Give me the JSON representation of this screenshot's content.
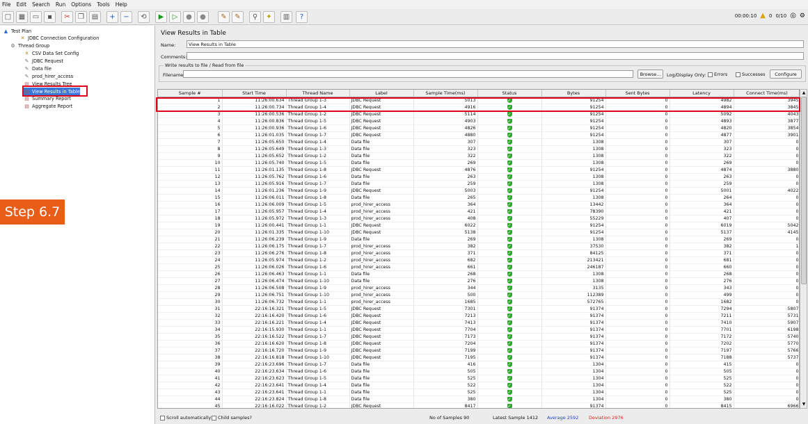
{
  "menu": [
    "File",
    "Edit",
    "Search",
    "Run",
    "Options",
    "Tools",
    "Help"
  ],
  "toolbar": {
    "timer": "00:00:10",
    "warnings": "0",
    "threads": "0/10"
  },
  "tree": [
    {
      "label": "Test Plan",
      "icon": "test-plan-icon"
    },
    {
      "label": "JDBC Connection Configuration",
      "icon": "config-icon"
    },
    {
      "label": "Thread Group",
      "icon": "thread-group-icon"
    },
    {
      "label": "CSV Data Set Config",
      "icon": "config-icon"
    },
    {
      "label": "JDBC Request",
      "icon": "sampler-icon"
    },
    {
      "label": "Data file",
      "icon": "sampler-icon"
    },
    {
      "label": "prod_hirer_access",
      "icon": "sampler-icon"
    },
    {
      "label": "View Results Tree",
      "icon": "listener-icon"
    },
    {
      "label": "View Results in Table",
      "icon": "listener-icon"
    },
    {
      "label": "Summary Report",
      "icon": "listener-icon"
    },
    {
      "label": "Aggregate Report",
      "icon": "listener-icon"
    }
  ],
  "step_label": "Step 6.7",
  "panel": {
    "title": "View Results in Table",
    "name_label": "Name:",
    "name_value": "View Results in Table",
    "comments_label": "Comments:",
    "write_group": "Write results to file / Read from file",
    "filename_label": "Filename",
    "browse": "Browse...",
    "log_display": "Log/Display Only:",
    "errors": "Errors",
    "successes": "Successes",
    "configure": "Configure"
  },
  "table": {
    "headers": [
      "Sample #",
      "Start Time",
      "Thread Name",
      "Label",
      "Sample Time(ms)",
      "Status",
      "Bytes",
      "Sent Bytes",
      "Latency",
      "Connect Time(ms)"
    ],
    "rows": [
      [
        "1",
        "11:26:00.634",
        "Thread Group 1-3",
        "JDBC Request",
        "5013",
        "91254",
        "0",
        "4982",
        "3945"
      ],
      [
        "2",
        "11:26:00.734",
        "Thread Group 1-4",
        "JDBC Request",
        "4916",
        "91254",
        "0",
        "4894",
        "3845"
      ],
      [
        "3",
        "11:26:00.536",
        "Thread Group 1-2",
        "JDBC Request",
        "5114",
        "91254",
        "0",
        "5092",
        "4043"
      ],
      [
        "4",
        "11:26:00.836",
        "Thread Group 1-5",
        "JDBC Request",
        "4903",
        "91254",
        "0",
        "4893",
        "3877"
      ],
      [
        "5",
        "11:26:00.936",
        "Thread Group 1-6",
        "JDBC Request",
        "4826",
        "91254",
        "0",
        "4820",
        "3854"
      ],
      [
        "6",
        "11:26:01.035",
        "Thread Group 1-7",
        "JDBC Request",
        "4880",
        "91254",
        "0",
        "4877",
        "3901"
      ],
      [
        "7",
        "11:26:05.650",
        "Thread Group 1-4",
        "Data file",
        "307",
        "1308",
        "0",
        "307",
        "0"
      ],
      [
        "8",
        "11:26:05.649",
        "Thread Group 1-3",
        "Data file",
        "323",
        "1308",
        "0",
        "323",
        "0"
      ],
      [
        "9",
        "11:26:05.652",
        "Thread Group 1-2",
        "Data file",
        "322",
        "1308",
        "0",
        "322",
        "0"
      ],
      [
        "10",
        "11:26:05.740",
        "Thread Group 1-5",
        "Data file",
        "269",
        "1308",
        "0",
        "269",
        "0"
      ],
      [
        "11",
        "11:26:01.135",
        "Thread Group 1-8",
        "JDBC Request",
        "4876",
        "91254",
        "0",
        "4874",
        "3880"
      ],
      [
        "12",
        "11:26:05.762",
        "Thread Group 1-6",
        "Data file",
        "263",
        "1308",
        "0",
        "263",
        "0"
      ],
      [
        "13",
        "11:26:05.916",
        "Thread Group 1-7",
        "Data file",
        "259",
        "1308",
        "0",
        "259",
        "0"
      ],
      [
        "14",
        "11:26:01.236",
        "Thread Group 1-9",
        "JDBC Request",
        "5003",
        "91254",
        "0",
        "5001",
        "4022"
      ],
      [
        "15",
        "11:26:06.011",
        "Thread Group 1-8",
        "Data file",
        "265",
        "1308",
        "0",
        "264",
        "0"
      ],
      [
        "16",
        "11:26:06.009",
        "Thread Group 1-5",
        "prod_hirer_access",
        "364",
        "13442",
        "0",
        "364",
        "0"
      ],
      [
        "17",
        "11:26:05.957",
        "Thread Group 1-4",
        "prod_hirer_access",
        "421",
        "78390",
        "0",
        "421",
        "0"
      ],
      [
        "18",
        "11:26:05.972",
        "Thread Group 1-3",
        "prod_hirer_access",
        "408",
        "55229",
        "0",
        "407",
        "0"
      ],
      [
        "19",
        "11:26:00.441",
        "Thread Group 1-1",
        "JDBC Request",
        "6022",
        "91254",
        "0",
        "6019",
        "5042"
      ],
      [
        "20",
        "11:26:01.335",
        "Thread Group 1-10",
        "JDBC Request",
        "5138",
        "91254",
        "0",
        "5137",
        "4145"
      ],
      [
        "21",
        "11:26:06.239",
        "Thread Group 1-9",
        "Data file",
        "269",
        "1308",
        "0",
        "269",
        "0"
      ],
      [
        "22",
        "11:26:06.175",
        "Thread Group 1-7",
        "prod_hirer_access",
        "382",
        "37530",
        "0",
        "382",
        "1"
      ],
      [
        "23",
        "11:26:06.276",
        "Thread Group 1-8",
        "prod_hirer_access",
        "371",
        "84125",
        "0",
        "371",
        "0"
      ],
      [
        "24",
        "11:26:05.974",
        "Thread Group 1-2",
        "prod_hirer_access",
        "682",
        "213421",
        "0",
        "681",
        "0"
      ],
      [
        "25",
        "11:26:06.026",
        "Thread Group 1-6",
        "prod_hirer_access",
        "661",
        "246187",
        "0",
        "660",
        "0"
      ],
      [
        "26",
        "11:26:06.463",
        "Thread Group 1-1",
        "Data file",
        "268",
        "1308",
        "0",
        "268",
        "0"
      ],
      [
        "27",
        "11:26:06.474",
        "Thread Group 1-10",
        "Data file",
        "276",
        "1308",
        "0",
        "276",
        "0"
      ],
      [
        "28",
        "11:26:06.508",
        "Thread Group 1-9",
        "prod_hirer_access",
        "344",
        "3135",
        "0",
        "343",
        "0"
      ],
      [
        "29",
        "11:26:06.751",
        "Thread Group 1-10",
        "prod_hirer_access",
        "500",
        "112389",
        "0",
        "499",
        "0"
      ],
      [
        "30",
        "11:26:06.732",
        "Thread Group 1-1",
        "prod_hirer_access",
        "1685",
        "572765",
        "0",
        "1682",
        "0"
      ],
      [
        "31",
        "22:16:16.321",
        "Thread Group 1-5",
        "JDBC Request",
        "7301",
        "91374",
        "0",
        "7294",
        "5807"
      ],
      [
        "32",
        "22:16:16.420",
        "Thread Group 1-6",
        "JDBC Request",
        "7213",
        "91374",
        "0",
        "7211",
        "5731"
      ],
      [
        "33",
        "22:16:16.221",
        "Thread Group 1-4",
        "JDBC Request",
        "7413",
        "91374",
        "0",
        "7410",
        "5907"
      ],
      [
        "34",
        "22:16:15.930",
        "Thread Group 1-1",
        "JDBC Request",
        "7704",
        "91374",
        "0",
        "7701",
        "6198"
      ],
      [
        "35",
        "22:16:16.522",
        "Thread Group 1-7",
        "JDBC Request",
        "7173",
        "91374",
        "0",
        "7172",
        "5740"
      ],
      [
        "36",
        "22:16:16.620",
        "Thread Group 1-8",
        "JDBC Request",
        "7204",
        "91374",
        "0",
        "7202",
        "5770"
      ],
      [
        "37",
        "22:16:16.720",
        "Thread Group 1-9",
        "JDBC Request",
        "7199",
        "91374",
        "0",
        "7197",
        "5766"
      ],
      [
        "38",
        "22:16:16.818",
        "Thread Group 1-10",
        "JDBC Request",
        "7195",
        "91374",
        "0",
        "7188",
        "5737"
      ],
      [
        "39",
        "22:16:23.696",
        "Thread Group 1-7",
        "Data file",
        "416",
        "1304",
        "0",
        "415",
        "0"
      ],
      [
        "40",
        "22:16:23.634",
        "Thread Group 1-6",
        "Data file",
        "505",
        "1304",
        "0",
        "505",
        "0"
      ],
      [
        "41",
        "22:16:23.623",
        "Thread Group 1-5",
        "Data file",
        "525",
        "1304",
        "0",
        "525",
        "0"
      ],
      [
        "42",
        "22:16:23.641",
        "Thread Group 1-4",
        "Data file",
        "522",
        "1304",
        "0",
        "522",
        "0"
      ],
      [
        "43",
        "22:16:23.641",
        "Thread Group 1-1",
        "Data file",
        "525",
        "1304",
        "0",
        "525",
        "0"
      ],
      [
        "44",
        "22:16:23.824",
        "Thread Group 1-8",
        "Data file",
        "380",
        "1304",
        "0",
        "380",
        "0"
      ],
      [
        "45",
        "22:16:16.022",
        "Thread Group 1-2",
        "JDBC Request",
        "8417",
        "91374",
        "0",
        "8415",
        "6966"
      ],
      [
        "46",
        "22:16:16.121",
        "Thread Group 1-3",
        "JDBC Request",
        "8323",
        "91374",
        "0",
        "8321",
        "6865"
      ]
    ]
  },
  "bottom": {
    "scroll_auto": "Scroll automatically?",
    "child_samples": "Child samples?",
    "no_samples_label": "No of Samples",
    "no_samples": "90",
    "latest_label": "Latest Sample",
    "latest": "1412",
    "average_label": "Average",
    "average": "2592",
    "deviation_label": "Deviation",
    "deviation": "2976"
  },
  "colors": {
    "average": "#1f3fd1",
    "deviation": "#d61f1f",
    "highlight": "#e0001b",
    "step": "#e85d18"
  }
}
